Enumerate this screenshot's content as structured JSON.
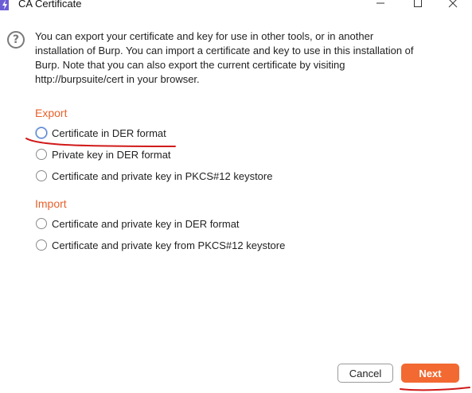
{
  "window": {
    "title": "CA Certificate",
    "icon": "burp-bolt-icon",
    "controls": [
      "minimize",
      "maximize",
      "close"
    ]
  },
  "description": "You can export your certificate and key for use in other tools, or in another\ninstallation of Burp. You can import a certificate and key to use in this installation of\nBurp. Note that you can also export the current certificate by visiting\nhttp://burpsuite/cert in your browser.",
  "export": {
    "title": "Export",
    "options": [
      {
        "label": "Certificate in DER format",
        "selected": false,
        "focused": true
      },
      {
        "label": "Private key in DER format",
        "selected": false
      },
      {
        "label": "Certificate and private key in PKCS#12 keystore",
        "selected": false
      }
    ]
  },
  "import": {
    "title": "Import",
    "options": [
      {
        "label": "Certificate and private key in DER format",
        "selected": false
      },
      {
        "label": "Certificate and private key from PKCS#12 keystore",
        "selected": false
      }
    ]
  },
  "buttons": {
    "cancel": "Cancel",
    "next": "Next"
  },
  "colors": {
    "accent": "#e8612c",
    "next_button": "#f26a32",
    "annotation": "#d11a1a",
    "app_icon": "#6b5cd6"
  }
}
